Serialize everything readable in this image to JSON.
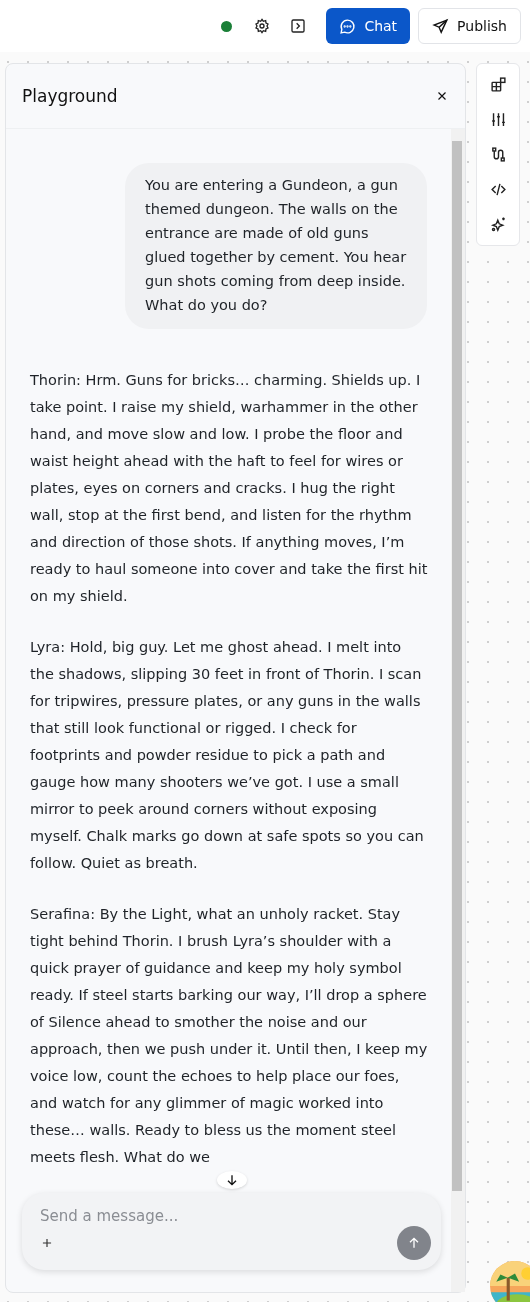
{
  "topbar": {
    "status": {
      "color": "#1a7f37"
    },
    "buttons": [
      {
        "kind": "primary",
        "label": "Chat"
      },
      {
        "kind": "secondary",
        "label": "Publish"
      }
    ]
  },
  "panel": {
    "title": "Playground"
  },
  "messages": [
    {
      "kind": "user",
      "text": "You are entering a Gundeon, a gun themed dungeon. The walls on the entrance are made of old guns glued together by cement. You hear gun shots coming from deep inside. What do you do?"
    },
    {
      "kind": "assistant",
      "paragraphs": [
        "Thorin: Hrm. Guns for bricks… charming. Shields up. I take point. I raise my shield, warhammer in the other hand, and move slow and low. I probe the floor and waist height ahead with the haft to feel for wires or plates, eyes on corners and cracks. I hug the right wall, stop at the first bend, and listen for the rhythm and direction of those shots. If anything moves, I’m ready to haul someone into cover and take the first hit on my shield.",
        "Lyra: Hold, big guy. Let me ghost ahead. I melt into the shadows, slipping 30 feet in front of Thorin. I scan for tripwires, pressure plates, or any guns in the walls that still look functional or rigged. I check for footprints and powder residue to pick a path and gauge how many shooters we’ve got. I use a small mirror to peek around corners without exposing myself. Chalk marks go down at safe spots so you can follow. Quiet as breath.",
        "Serafina: By the Light, what an unholy racket. Stay tight behind Thorin. I brush Lyra’s shoulder with a quick prayer of guidance and keep my holy symbol ready. If steel starts barking our way, I’ll drop a sphere of Silence ahead to smother the noise and our approach, then we push under it. Until then, I keep my voice low, count the echoes to help place our foes, and watch for any glimmer of magic worked into these… walls. Ready to bless us the moment steel meets flesh. What do we"
      ]
    }
  ],
  "composer": {
    "placeholder": "Send a message..."
  }
}
